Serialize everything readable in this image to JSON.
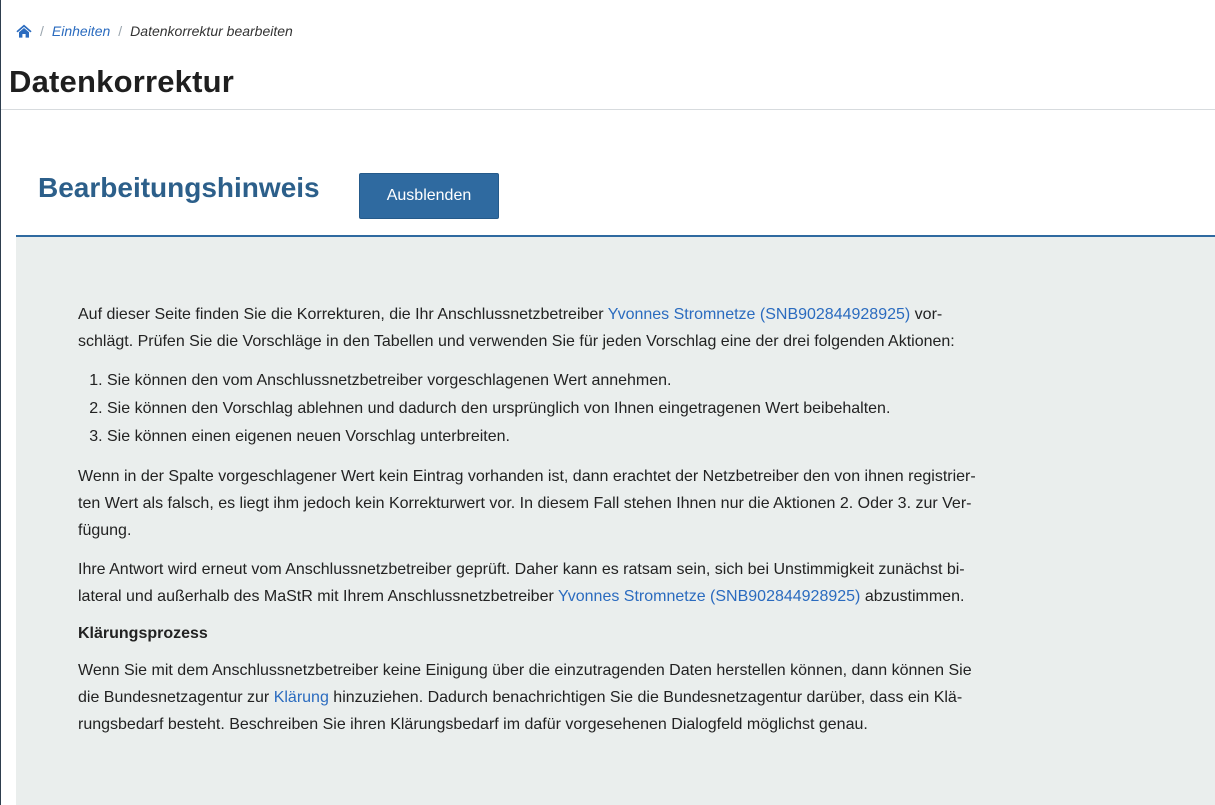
{
  "breadcrumb": {
    "home_icon": "home-icon",
    "separator": "/",
    "items": [
      {
        "label": "Einheiten"
      },
      {
        "label": "Datenkorrektur bearbeiten"
      }
    ]
  },
  "page_title": "Datenkorrektur",
  "section": {
    "heading": "Bearbeitungshinweis",
    "toggle_label": "Ausblenden"
  },
  "info": {
    "p1": {
      "before": "Auf dieser Seite finden Sie die Korrekturen, die Ihr Anschlussnetzbetreiber ",
      "link": "Yvonnes Stromnetze (SNB902844928925)",
      "after_line1": " vor-",
      "line2": "schlägt. Prüfen Sie die Vorschläge in den Tabellen und verwenden Sie für jeden Vorschlag eine der drei folgenden Aktionen:"
    },
    "steps": [
      "Sie können den vom Anschlussnetzbetreiber vorgeschlagenen Wert annehmen.",
      "Sie können den Vorschlag ablehnen und dadurch den ursprünglich von Ihnen eingetragenen Wert beibehalten.",
      "Sie können einen eigenen neuen Vorschlag unterbreiten."
    ],
    "p2": {
      "line1": "Wenn in der Spalte vorgeschlagener Wert kein Eintrag vorhanden ist, dann erachtet der Netzbetreiber den von ihnen registrier-",
      "line2": "ten Wert als falsch, es liegt ihm jedoch kein Korrekturwert vor. In diesem Fall stehen Ihnen nur die Aktionen 2. Oder 3. zur Ver-",
      "line3": "fügung."
    },
    "p3": {
      "line1": "Ihre Antwort wird erneut vom Anschlussnetzbetreiber geprüft. Daher kann es ratsam sein, sich bei Unstimmigkeit zunächst bi-",
      "line2_before": "lateral und außerhalb des MaStR mit Ihrem Anschlussnetzbetreiber ",
      "link": "Yvonnes Stromnetze (SNB902844928925)",
      "line2_after": " abzustimmen."
    },
    "clarification_heading": "Klärungsprozess",
    "p4": {
      "line1": "Wenn Sie mit dem Anschlussnetzbetreiber keine Einigung über die einzutragenden Daten herstellen können, dann können Sie",
      "line2_before": "die Bundesnetzagentur zur ",
      "link": "Klärung",
      "line2_after": " hinzuziehen. Dadurch benachrichtigen Sie die Bundesnetzagentur darüber, dass ein Klä-",
      "line3": "rungsbedarf besteht. Beschreiben Sie ihren Klärungsbedarf im dafür vorgesehenen Dialogfeld möglichst genau."
    }
  },
  "colors": {
    "link": "#2a6bbf",
    "heading": "#2c5f8a",
    "button": "#2f6aa0",
    "panel": "#eaeeed"
  }
}
